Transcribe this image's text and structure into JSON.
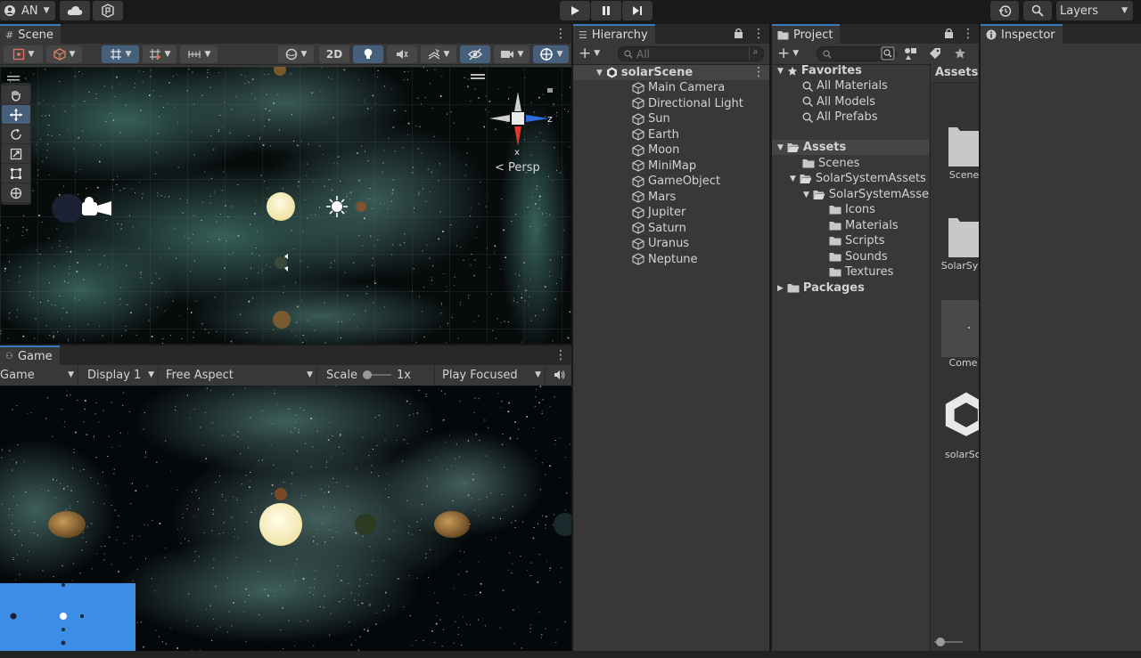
{
  "toolbar": {
    "account_label": "AN",
    "layers_label": "Layers"
  },
  "scene": {
    "tab_label": "Scene",
    "btn_2d": "2D",
    "gizmo_label": "Persp",
    "gizmo_axis_z": "z",
    "gizmo_axis_x": "x"
  },
  "game": {
    "tab_label": "Game",
    "view_mode": "Game",
    "display": "Display 1",
    "aspect": "Free Aspect",
    "scale_label": "Scale",
    "scale_value": "1x",
    "play_mode": "Play Focused"
  },
  "hierarchy": {
    "tab_label": "Hierarchy",
    "search_placeholder": "All",
    "scene_name": "solarScene",
    "items": [
      {
        "label": "Main Camera"
      },
      {
        "label": "Directional Light"
      },
      {
        "label": "Sun"
      },
      {
        "label": "Earth"
      },
      {
        "label": "Moon"
      },
      {
        "label": "MiniMap"
      },
      {
        "label": "GameObject"
      },
      {
        "label": "Mars"
      },
      {
        "label": "Jupiter"
      },
      {
        "label": "Saturn"
      },
      {
        "label": "Uranus"
      },
      {
        "label": "Neptune"
      }
    ]
  },
  "project": {
    "tab_label": "Project",
    "favorites_label": "Favorites",
    "favorites": [
      {
        "label": "All Materials"
      },
      {
        "label": "All Models"
      },
      {
        "label": "All Prefabs"
      }
    ],
    "assets_label": "Assets",
    "assets_folders": {
      "scenes": "Scenes",
      "solar_system_assets": "SolarSystemAssets",
      "solar_system_assets_inner": "SolarSystemAsse",
      "inner": [
        {
          "label": "Icons"
        },
        {
          "label": "Materials"
        },
        {
          "label": "Scripts"
        },
        {
          "label": "Sounds"
        },
        {
          "label": "Textures"
        }
      ]
    },
    "packages_label": "Packages",
    "grid_header": "Assets",
    "grid_items": [
      {
        "label": "Scene"
      },
      {
        "label": "SolarSy"
      },
      {
        "label": "Come"
      },
      {
        "label": "solarSc"
      }
    ]
  },
  "inspector": {
    "tab_label": "Inspector"
  }
}
